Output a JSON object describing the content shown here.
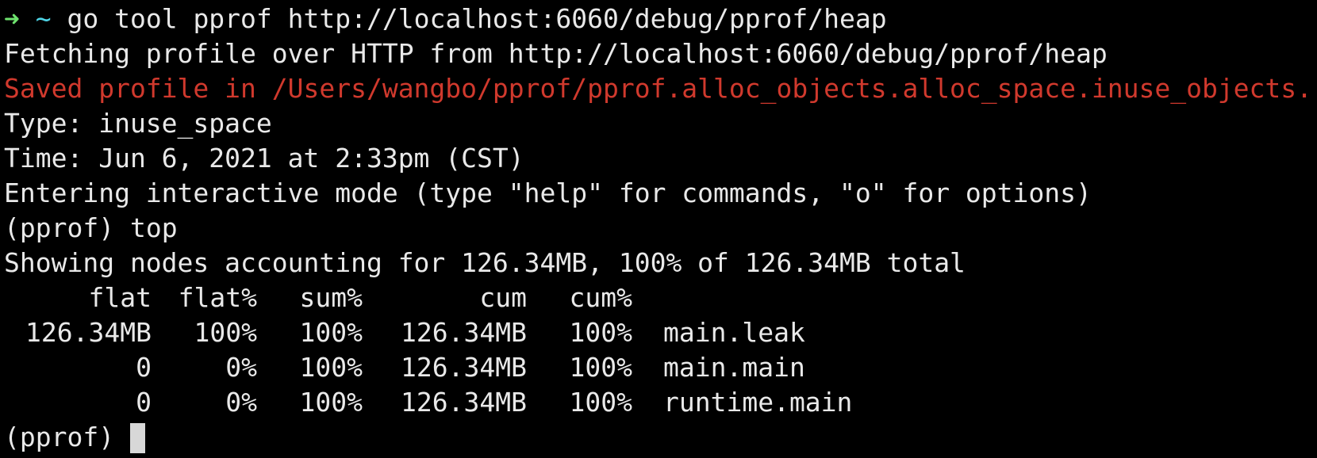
{
  "terminal": {
    "command_line": {
      "arrow": "➜",
      "tilde": "~",
      "command": "go tool pprof http://localhost:6060/debug/pprof/heap"
    },
    "fetching": "Fetching profile over HTTP from http://localhost:6060/debug/pprof/heap",
    "saved": "Saved profile in /Users/wangbo/pprof/pprof.alloc_objects.alloc_space.inuse_objects.",
    "type_line": "Type: inuse_space",
    "time_line": "Time: Jun 6, 2021 at 2:33pm (CST)",
    "interactive": "Entering interactive mode (type \"help\" for commands, \"o\" for options)",
    "pprof_prompt": "(pprof)",
    "top_command": "top",
    "summary": "Showing nodes accounting for 126.34MB, 100% of 126.34MB total",
    "table": {
      "headers": [
        "flat",
        "flat%",
        "sum%",
        "cum",
        "cum%"
      ],
      "rows": [
        {
          "flat": "126.34MB",
          "flat_pct": "100%",
          "sum_pct": "100%",
          "cum": "126.34MB",
          "cum_pct": "100%",
          "func": "main.leak"
        },
        {
          "flat": "0",
          "flat_pct": "0%",
          "sum_pct": "100%",
          "cum": "126.34MB",
          "cum_pct": "100%",
          "func": "main.main"
        },
        {
          "flat": "0",
          "flat_pct": "0%",
          "sum_pct": "100%",
          "cum": "126.34MB",
          "cum_pct": "100%",
          "func": "runtime.main"
        }
      ]
    },
    "final_prompt": "(pprof)"
  },
  "colors": {
    "background": "#000000",
    "text": "#e9e9e9",
    "prompt_arrow": "#6ee36e",
    "prompt_tilde": "#4fd6e8",
    "saved_line": "#d0392d",
    "cursor": "#d8d8d8"
  }
}
